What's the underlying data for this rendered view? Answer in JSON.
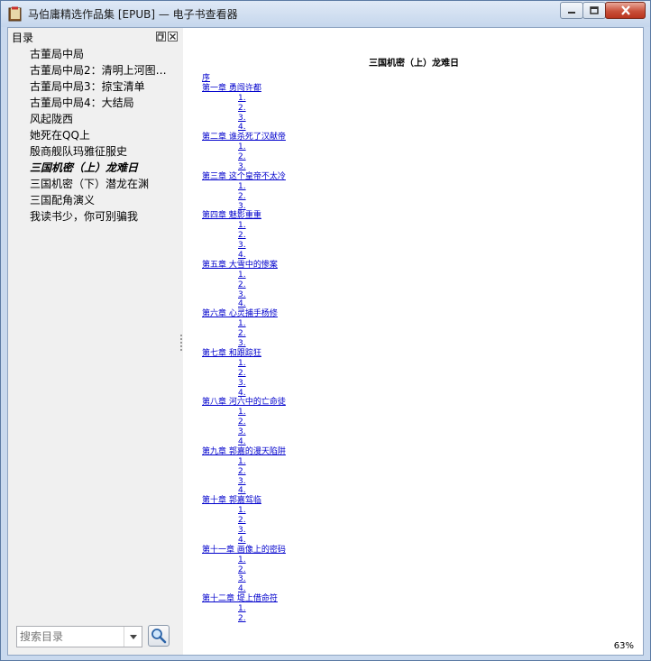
{
  "window": {
    "title": "马伯庸精选作品集 [EPUB] — 电子书查看器"
  },
  "sidebar": {
    "header": "目录",
    "items": [
      {
        "label": "古董局中局",
        "current": false
      },
      {
        "label": "古董局中局2：清明上河图…",
        "current": false
      },
      {
        "label": "古董局中局3：掠宝清单",
        "current": false
      },
      {
        "label": "古董局中局4：大结局",
        "current": false
      },
      {
        "label": "风起陇西",
        "current": false
      },
      {
        "label": "她死在QQ上",
        "current": false
      },
      {
        "label": "殷商舰队玛雅征服史",
        "current": false
      },
      {
        "label": "三国机密（上）龙难日",
        "current": true
      },
      {
        "label": "三国机密（下）潜龙在渊",
        "current": false
      },
      {
        "label": "三国配角演义",
        "current": false
      },
      {
        "label": "我读书少，你可别骗我",
        "current": false
      }
    ],
    "search_placeholder": "搜索目录"
  },
  "content": {
    "title": "三国机密（上）龙难日",
    "preface": "序",
    "chapters": [
      {
        "title": "第一章 勇闯许都",
        "sections": [
          "1.",
          "2.",
          "3.",
          "4."
        ]
      },
      {
        "title": "第二章 谁杀死了汉献帝",
        "sections": [
          "1.",
          "2.",
          "3."
        ]
      },
      {
        "title": "第三章 这个皇帝不太冷",
        "sections": [
          "1.",
          "2.",
          "3."
        ]
      },
      {
        "title": "第四章 魅影重重",
        "sections": [
          "1.",
          "2.",
          "3.",
          "4."
        ]
      },
      {
        "title": "第五章 大雪中的惨案",
        "sections": [
          "1.",
          "2.",
          "3.",
          "4."
        ]
      },
      {
        "title": "第六章 心灵捕手杨修",
        "sections": [
          "1.",
          "2.",
          "3."
        ]
      },
      {
        "title": "第七章 和跟踪狂",
        "sections": [
          "1.",
          "2.",
          "3.",
          "4."
        ]
      },
      {
        "title": "第八章 河六中的亡命徒",
        "sections": [
          "1.",
          "2.",
          "3.",
          "4."
        ]
      },
      {
        "title": "第九章 郭嘉的漫天陷阱",
        "sections": [
          "1.",
          "2.",
          "3.",
          "4."
        ]
      },
      {
        "title": "第十章 郭嘉驾临",
        "sections": [
          "1.",
          "2.",
          "3.",
          "4."
        ]
      },
      {
        "title": "第十一章 画像上的密码",
        "sections": [
          "1.",
          "2.",
          "3.",
          "4."
        ]
      },
      {
        "title": "第十二章 堤上借命符",
        "sections": [
          "1.",
          "2."
        ]
      }
    ],
    "zoom": "63%"
  }
}
